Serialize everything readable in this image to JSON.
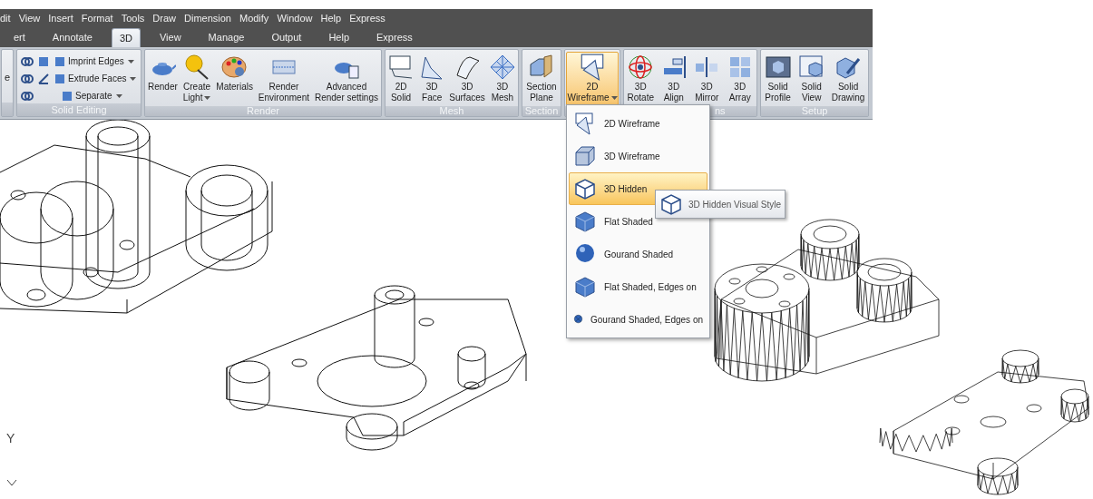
{
  "menu_bar": [
    "dit",
    "View",
    "Insert",
    "Format",
    "Tools",
    "Draw",
    "Dimension",
    "Modify",
    "Window",
    "Help",
    "Express"
  ],
  "tabs": [
    {
      "label": "ert",
      "selected": false
    },
    {
      "label": "Annotate",
      "selected": false
    },
    {
      "label": "3D",
      "selected": true
    },
    {
      "label": "View",
      "selected": false
    },
    {
      "label": "Manage",
      "selected": false
    },
    {
      "label": "Output",
      "selected": false
    },
    {
      "label": "Help",
      "selected": false
    },
    {
      "label": "Express",
      "selected": false
    }
  ],
  "ribbon": {
    "groups": [
      {
        "kind": "partial",
        "items": [
          {
            "lines": [
              "e"
            ]
          }
        ]
      },
      {
        "kind": "small",
        "title": "Solid Editing",
        "items": [
          {
            "lines": [
              "Imprint Edges"
            ],
            "dropdown": true
          },
          {
            "lines": [
              "Extrude Faces"
            ],
            "dropdown": true
          },
          {
            "lines": [
              "Separate"
            ],
            "dropdown": true
          }
        ]
      },
      {
        "kind": "large",
        "title": "Render",
        "items": [
          {
            "lines": [
              "Render"
            ],
            "dropdown": false,
            "selected": false
          },
          {
            "lines": [
              "Create",
              "Light"
            ],
            "dropdown": true,
            "selected": false
          },
          {
            "lines": [
              "Materials"
            ],
            "dropdown": false,
            "selected": false
          },
          {
            "lines": [
              "Render",
              "Environment"
            ],
            "dropdown": false,
            "selected": false
          },
          {
            "lines": [
              "Advanced",
              "Render settings"
            ],
            "dropdown": false,
            "selected": false
          }
        ]
      },
      {
        "kind": "large",
        "title": "Mesh",
        "items": [
          {
            "lines": [
              "2D",
              "Solid"
            ],
            "dropdown": false,
            "selected": false
          },
          {
            "lines": [
              "3D",
              "Face"
            ],
            "dropdown": false,
            "selected": false
          },
          {
            "lines": [
              "3D",
              "Surfaces"
            ],
            "dropdown": false,
            "selected": false
          },
          {
            "lines": [
              "3D",
              "Mesh"
            ],
            "dropdown": false,
            "selected": false
          }
        ]
      },
      {
        "kind": "large",
        "title": "Section",
        "items": [
          {
            "lines": [
              "Section",
              "Plane"
            ],
            "dropdown": false,
            "selected": false
          }
        ]
      },
      {
        "kind": "large",
        "items": [
          {
            "lines": [
              "2D",
              "Wireframe"
            ],
            "dropdown": true,
            "selected": true
          }
        ]
      },
      {
        "kind": "large",
        "title": "ns",
        "items": [
          {
            "lines": [
              "3D",
              "Rotate"
            ],
            "dropdown": false,
            "selected": false
          },
          {
            "lines": [
              "3D",
              "Align"
            ],
            "dropdown": false,
            "selected": false
          },
          {
            "lines": [
              "3D",
              "Mirror"
            ],
            "dropdown": false,
            "selected": false
          },
          {
            "lines": [
              "3D",
              "Array"
            ],
            "dropdown": false,
            "selected": false
          }
        ]
      },
      {
        "kind": "large",
        "title": "Setup",
        "items": [
          {
            "lines": [
              "Solid",
              "Profile"
            ],
            "dropdown": false,
            "selected": false
          },
          {
            "lines": [
              "Solid",
              "View"
            ],
            "dropdown": false,
            "selected": false
          },
          {
            "lines": [
              "Solid",
              "Drawing"
            ],
            "dropdown": false,
            "selected": false
          }
        ]
      }
    ]
  },
  "visual_style_menu": {
    "items": [
      {
        "label": "2D Wireframe",
        "selected": false
      },
      {
        "label": "3D Wireframe",
        "selected": false
      },
      {
        "label": "3D Hidden",
        "selected": true
      },
      {
        "label": "Flat Shaded",
        "selected": false
      },
      {
        "label": "Gourand Shaded",
        "selected": false
      },
      {
        "label": "Flat Shaded, Edges on",
        "selected": false
      },
      {
        "label": "Gourand Shaded, Edges on",
        "selected": false
      }
    ]
  },
  "tooltip": {
    "text": "3D Hidden Visual Style"
  },
  "ucs_label": "Y"
}
